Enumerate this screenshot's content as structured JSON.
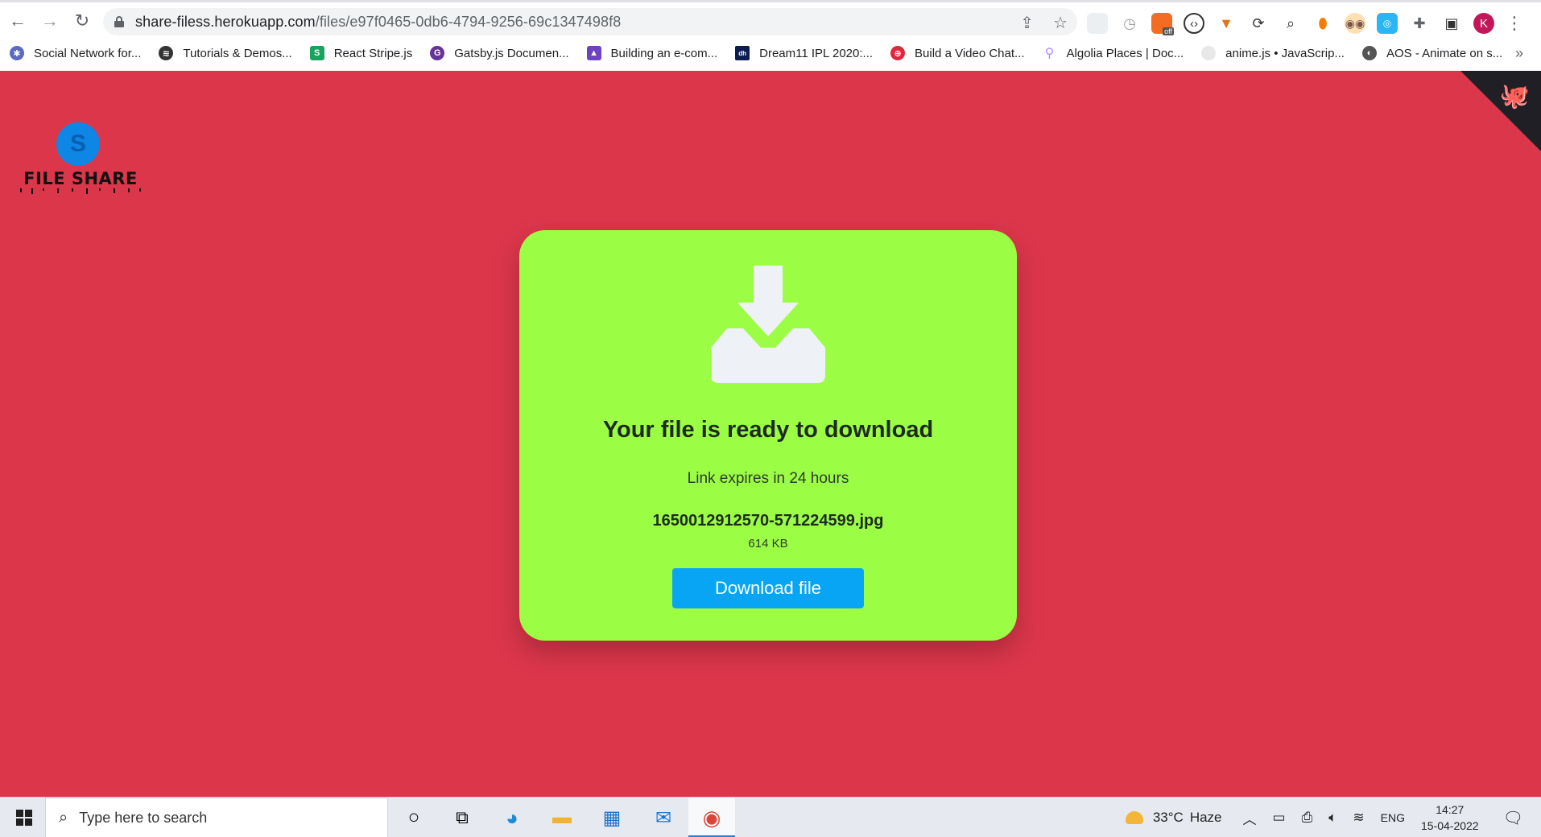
{
  "browser": {
    "url_host": "share-filess.herokuapp.com",
    "url_path": "/files/e97f0465-0db6-4794-9256-69c1347498f8",
    "profile_initial": "K",
    "ext_badge": "off",
    "bookmarks": [
      {
        "label": "Social Network for...",
        "icon": "network-icon",
        "color": "#5c6bc0"
      },
      {
        "label": "Tutorials & Demos...",
        "icon": "stack-icon",
        "color": "#333333"
      },
      {
        "label": "React Stripe.js",
        "icon": "stripe-s-icon",
        "color": "#1aa260"
      },
      {
        "label": "Gatsby.js Documen...",
        "icon": "gatsby-icon",
        "color": "#663399"
      },
      {
        "label": "Building an e-com...",
        "icon": "rocket-icon",
        "color": "#6f42c1"
      },
      {
        "label": "Dream11 IPL 2020:...",
        "icon": "dh-icon",
        "color": "#0b1d51"
      },
      {
        "label": "Build a Video Chat...",
        "icon": "lifebuoy-icon",
        "color": "#e0283c"
      },
      {
        "label": "Algolia Places | Doc...",
        "icon": "pin-icon",
        "color": "#b388ff"
      },
      {
        "label": "anime.js • JavaScrip...",
        "icon": "anime-icon",
        "color": "#e8e8e8"
      },
      {
        "label": "AOS - Animate on s...",
        "icon": "aos-icon",
        "color": "#555555"
      }
    ]
  },
  "page": {
    "logo_text": "FILE SHARE",
    "logo_mark": "S",
    "card": {
      "title": "Your file is ready to download",
      "expiry": "Link expires in 24 hours",
      "filename": "1650012912570-571224599.jpg",
      "filesize": "614 KB",
      "button_label": "Download file"
    },
    "colors": {
      "background": "#dc364b",
      "card": "#9bfe45",
      "button": "#08a5f5"
    }
  },
  "taskbar": {
    "search_placeholder": "Type here to search",
    "temperature": "33°C",
    "weather": "Haze",
    "language": "ENG",
    "time": "14:27",
    "date": "15-04-2022"
  }
}
